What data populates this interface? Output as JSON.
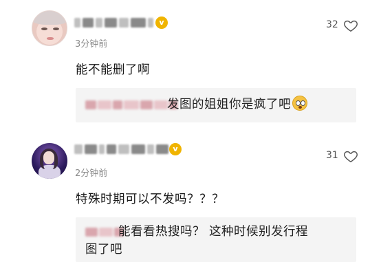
{
  "comments": [
    {
      "time": "3分钟前",
      "likes": "32",
      "text": "能不能删了啊",
      "reply": {
        "text": "发图的姐姐你是疯了吧",
        "emoji": "surprised-face-emoji"
      },
      "badge": "v"
    },
    {
      "time": "2分钟前",
      "likes": "31",
      "text": "特殊时期可以不发吗？？？",
      "reply": {
        "line1": "能看看热搜吗？ 这种时候别发行程",
        "line2": "图了吧"
      },
      "badge": "v"
    }
  ],
  "colors": {
    "badge": "#f0b400",
    "reply_bg": "#f4f4f4",
    "time": "#8c8c8c"
  },
  "icons": [
    "heart-outline-icon",
    "verified-badge-icon"
  ]
}
